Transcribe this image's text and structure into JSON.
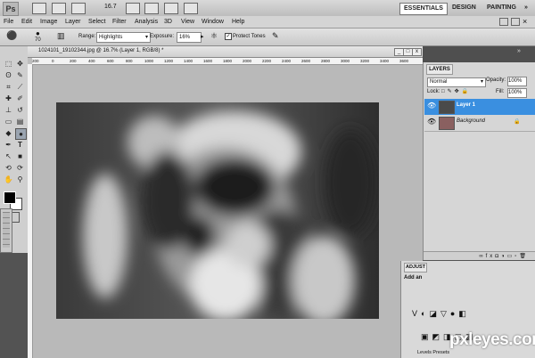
{
  "app": {
    "logo": "Ps",
    "zoom": "16.7"
  },
  "workspace": {
    "essentials": "ESSENTIALS",
    "design": "DESIGN",
    "painting": "PAINTING",
    "more": "»"
  },
  "menu": [
    "File",
    "Edit",
    "Image",
    "Layer",
    "Select",
    "Filter",
    "Analysis",
    "3D",
    "View",
    "Window",
    "Help"
  ],
  "options": {
    "brush_size": "70",
    "range_label": "Range:",
    "range_value": "Highlights",
    "exposure_label": "Exposure:",
    "exposure_value": "16%",
    "protect_label": "Protect Tones"
  },
  "document": {
    "title": "1024101_19102344.jpg @ 16.7% (Layer 1, RGB/8) *",
    "ruler_ticks": [
      "200",
      "0",
      "200",
      "400",
      "600",
      "800",
      "1000",
      "1200",
      "1400",
      "1600",
      "1800",
      "2000",
      "2200",
      "2400",
      "2600",
      "2800",
      "3000",
      "3200",
      "3400",
      "3600"
    ]
  },
  "layers_panel": {
    "tab": "LAYERS",
    "blend_mode": "Normal",
    "opacity_label": "Opacity:",
    "opacity_value": "100%",
    "lock_label": "Lock:",
    "fill_label": "Fill:",
    "fill_value": "100%",
    "layers": [
      {
        "name": "Layer 1",
        "selected": true
      },
      {
        "name": "Background",
        "selected": false
      }
    ]
  },
  "adjustments": {
    "tab": "ADJUST",
    "title": "Add an",
    "preset": "Levels Presets"
  },
  "watermark": "pxleyes.com"
}
